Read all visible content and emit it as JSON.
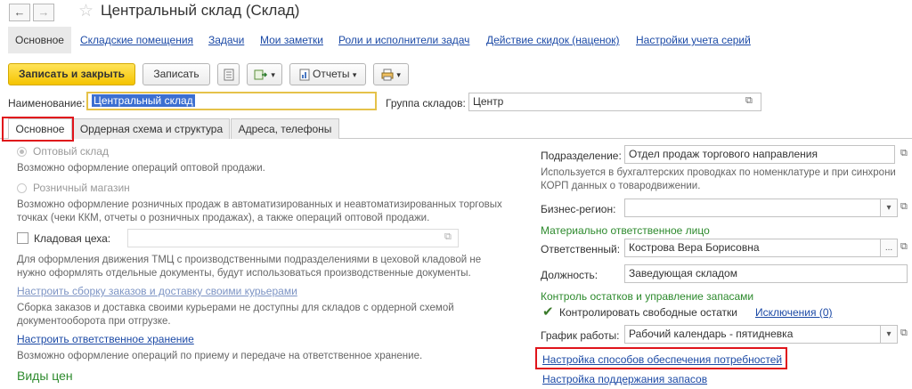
{
  "window": {
    "title": "Центральный склад (Склад)",
    "back_glyph": "←",
    "forward_glyph": "→",
    "star_glyph": "☆"
  },
  "top_tabs": [
    {
      "label": "Основное",
      "active": true
    },
    {
      "label": "Складские помещения"
    },
    {
      "label": "Задачи"
    },
    {
      "label": "Мои заметки"
    },
    {
      "label": "Роли и исполнители задач"
    },
    {
      "label": "Действие скидок (наценок)"
    },
    {
      "label": "Настройки учета серий"
    }
  ],
  "toolbar": {
    "save_close": "Записать и закрыть",
    "save": "Записать",
    "reports": "Отчеты",
    "dropdown_glyph": "▾"
  },
  "header_fields": {
    "name_label": "Наименование:",
    "name_value": "Центральный склад",
    "group_label": "Группа складов:",
    "group_value": "Центр"
  },
  "content_tabs": [
    {
      "label": "Основное",
      "active": true
    },
    {
      "label": "Ордерная схема и структура"
    },
    {
      "label": "Адреса, телефоны"
    }
  ],
  "left": {
    "wholesale_label": "Оптовый склад",
    "wholesale_hint": "Возможно оформление операций оптовой продажи.",
    "retail_label": "Розничный магазин",
    "retail_hint_1": "Возможно оформление розничных продаж в автоматизированных и неавтоматизированных торговых",
    "retail_hint_2": "точках (чеки ККМ, отчеты о розничных продажах), а также операций оптовой продажи.",
    "shop_store_label": "Кладовая цеха:",
    "shop_store_hint_1": "Для оформления движения ТМЦ с производственными подразделениями в цеховой кладовой не",
    "shop_store_hint_2": "нужно оформлять отдельные документы, будут использоваться производственные документы.",
    "courier_link": "Настроить сборку заказов и доставку своими курьерами",
    "courier_hint_1": "Сборка заказов и доставка своими курьерами не доступны для складов с ордерной схемой",
    "courier_hint_2": "документооборота при отгрузке.",
    "custody_link": "Настроить ответственное хранение",
    "custody_hint": "Возможно оформление операций по приему и передаче на ответственное хранение.",
    "price_types_title": "Виды цен"
  },
  "right": {
    "division_label": "Подразделение:",
    "division_value": "Отдел продаж торгового направления",
    "division_hint_1": "Используется в бухгалтерских проводках по номенклатуре и при синхрони",
    "division_hint_2": "КОРП данных о товародвижении.",
    "region_label": "Бизнес-регион:",
    "region_value": "",
    "mol_title": "Материально ответственное лицо",
    "responsible_label": "Ответственный:",
    "responsible_value": "Кострова Вера Борисовна",
    "position_label": "Должность:",
    "position_value": "Заведующая складом",
    "stock_title": "Контроль остатков и управление запасами",
    "control_label": "Контролировать свободные остатки",
    "control_checked": true,
    "exceptions_link": "Исключения (0)",
    "schedule_label": "График работы:",
    "schedule_value": "Рабочий календарь - пятидневка",
    "needs_link": "Настройка способов обеспечения потребностей",
    "stock_link": "Настройка поддержания запасов"
  },
  "glyphs": {
    "open": "⧉",
    "dots": "...",
    "check": "✔"
  },
  "colors": {
    "accent_yellow": "#f5c400",
    "link_blue": "#1c4aa6",
    "section_green": "#2d8a2d",
    "highlight_red": "#e0141b",
    "selection_blue": "#3c6fd1"
  }
}
